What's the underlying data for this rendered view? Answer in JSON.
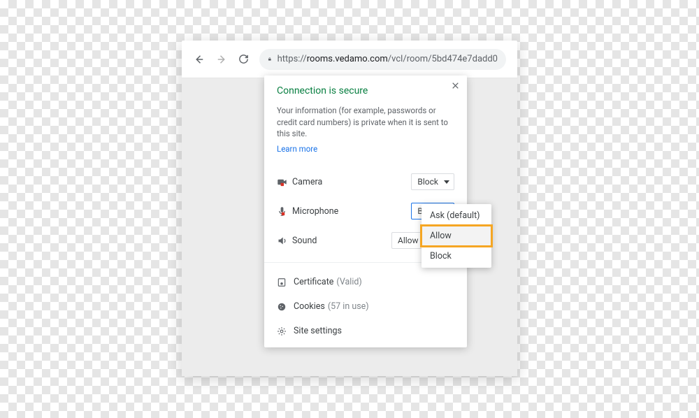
{
  "toolbar": {
    "url_prefix": "https://",
    "url_host": "rooms.vedamo.com",
    "url_path": "/vcl/room/5bd474e7dadd0"
  },
  "popover": {
    "title": "Connection is secure",
    "body": "Your information (for example, passwords or credit card numbers) is private when it is sent to this site.",
    "learn_more": "Learn more",
    "permissions": [
      {
        "icon": "camera-icon",
        "label": "Camera",
        "value": "Block",
        "focused": false
      },
      {
        "icon": "microphone-icon",
        "label": "Microphone",
        "value": "Block",
        "focused": true
      },
      {
        "icon": "sound-icon",
        "label": "Sound",
        "value": "Allow (",
        "focused": false
      }
    ],
    "info": {
      "certificate_label": "Certificate",
      "certificate_status": "(Valid)",
      "cookies_label": "Cookies",
      "cookies_count": "(57 in use)",
      "site_settings": "Site settings"
    }
  },
  "dropdown": {
    "options": [
      "Ask (default)",
      "Allow",
      "Block"
    ],
    "highlight_index": 1
  }
}
